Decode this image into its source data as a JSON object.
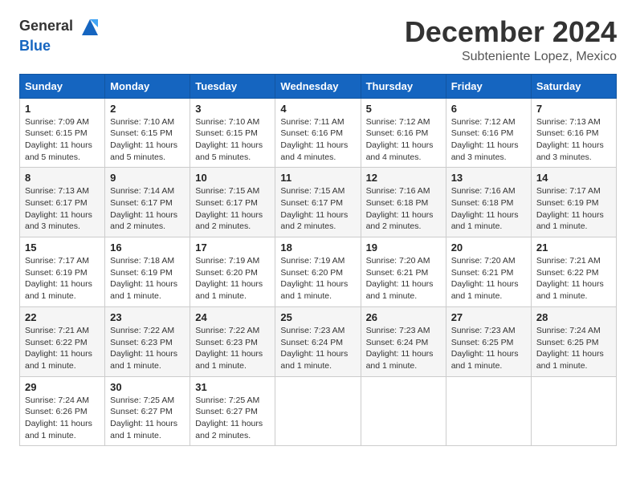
{
  "header": {
    "logo_general": "General",
    "logo_blue": "Blue",
    "month_title": "December 2024",
    "subtitle": "Subteniente Lopez, Mexico"
  },
  "calendar": {
    "days_of_week": [
      "Sunday",
      "Monday",
      "Tuesday",
      "Wednesday",
      "Thursday",
      "Friday",
      "Saturday"
    ],
    "weeks": [
      [
        {
          "day": "1",
          "sunrise": "7:09 AM",
          "sunset": "6:15 PM",
          "daylight": "11 hours and 5 minutes."
        },
        {
          "day": "2",
          "sunrise": "7:10 AM",
          "sunset": "6:15 PM",
          "daylight": "11 hours and 5 minutes."
        },
        {
          "day": "3",
          "sunrise": "7:10 AM",
          "sunset": "6:15 PM",
          "daylight": "11 hours and 5 minutes."
        },
        {
          "day": "4",
          "sunrise": "7:11 AM",
          "sunset": "6:16 PM",
          "daylight": "11 hours and 4 minutes."
        },
        {
          "day": "5",
          "sunrise": "7:12 AM",
          "sunset": "6:16 PM",
          "daylight": "11 hours and 4 minutes."
        },
        {
          "day": "6",
          "sunrise": "7:12 AM",
          "sunset": "6:16 PM",
          "daylight": "11 hours and 3 minutes."
        },
        {
          "day": "7",
          "sunrise": "7:13 AM",
          "sunset": "6:16 PM",
          "daylight": "11 hours and 3 minutes."
        }
      ],
      [
        {
          "day": "8",
          "sunrise": "7:13 AM",
          "sunset": "6:17 PM",
          "daylight": "11 hours and 3 minutes."
        },
        {
          "day": "9",
          "sunrise": "7:14 AM",
          "sunset": "6:17 PM",
          "daylight": "11 hours and 2 minutes."
        },
        {
          "day": "10",
          "sunrise": "7:15 AM",
          "sunset": "6:17 PM",
          "daylight": "11 hours and 2 minutes."
        },
        {
          "day": "11",
          "sunrise": "7:15 AM",
          "sunset": "6:17 PM",
          "daylight": "11 hours and 2 minutes."
        },
        {
          "day": "12",
          "sunrise": "7:16 AM",
          "sunset": "6:18 PM",
          "daylight": "11 hours and 2 minutes."
        },
        {
          "day": "13",
          "sunrise": "7:16 AM",
          "sunset": "6:18 PM",
          "daylight": "11 hours and 1 minute."
        },
        {
          "day": "14",
          "sunrise": "7:17 AM",
          "sunset": "6:19 PM",
          "daylight": "11 hours and 1 minute."
        }
      ],
      [
        {
          "day": "15",
          "sunrise": "7:17 AM",
          "sunset": "6:19 PM",
          "daylight": "11 hours and 1 minute."
        },
        {
          "day": "16",
          "sunrise": "7:18 AM",
          "sunset": "6:19 PM",
          "daylight": "11 hours and 1 minute."
        },
        {
          "day": "17",
          "sunrise": "7:19 AM",
          "sunset": "6:20 PM",
          "daylight": "11 hours and 1 minute."
        },
        {
          "day": "18",
          "sunrise": "7:19 AM",
          "sunset": "6:20 PM",
          "daylight": "11 hours and 1 minute."
        },
        {
          "day": "19",
          "sunrise": "7:20 AM",
          "sunset": "6:21 PM",
          "daylight": "11 hours and 1 minute."
        },
        {
          "day": "20",
          "sunrise": "7:20 AM",
          "sunset": "6:21 PM",
          "daylight": "11 hours and 1 minute."
        },
        {
          "day": "21",
          "sunrise": "7:21 AM",
          "sunset": "6:22 PM",
          "daylight": "11 hours and 1 minute."
        }
      ],
      [
        {
          "day": "22",
          "sunrise": "7:21 AM",
          "sunset": "6:22 PM",
          "daylight": "11 hours and 1 minute."
        },
        {
          "day": "23",
          "sunrise": "7:22 AM",
          "sunset": "6:23 PM",
          "daylight": "11 hours and 1 minute."
        },
        {
          "day": "24",
          "sunrise": "7:22 AM",
          "sunset": "6:23 PM",
          "daylight": "11 hours and 1 minute."
        },
        {
          "day": "25",
          "sunrise": "7:23 AM",
          "sunset": "6:24 PM",
          "daylight": "11 hours and 1 minute."
        },
        {
          "day": "26",
          "sunrise": "7:23 AM",
          "sunset": "6:24 PM",
          "daylight": "11 hours and 1 minute."
        },
        {
          "day": "27",
          "sunrise": "7:23 AM",
          "sunset": "6:25 PM",
          "daylight": "11 hours and 1 minute."
        },
        {
          "day": "28",
          "sunrise": "7:24 AM",
          "sunset": "6:25 PM",
          "daylight": "11 hours and 1 minute."
        }
      ],
      [
        {
          "day": "29",
          "sunrise": "7:24 AM",
          "sunset": "6:26 PM",
          "daylight": "11 hours and 1 minute."
        },
        {
          "day": "30",
          "sunrise": "7:25 AM",
          "sunset": "6:27 PM",
          "daylight": "11 hours and 1 minute."
        },
        {
          "day": "31",
          "sunrise": "7:25 AM",
          "sunset": "6:27 PM",
          "daylight": "11 hours and 2 minutes."
        },
        null,
        null,
        null,
        null
      ]
    ]
  }
}
